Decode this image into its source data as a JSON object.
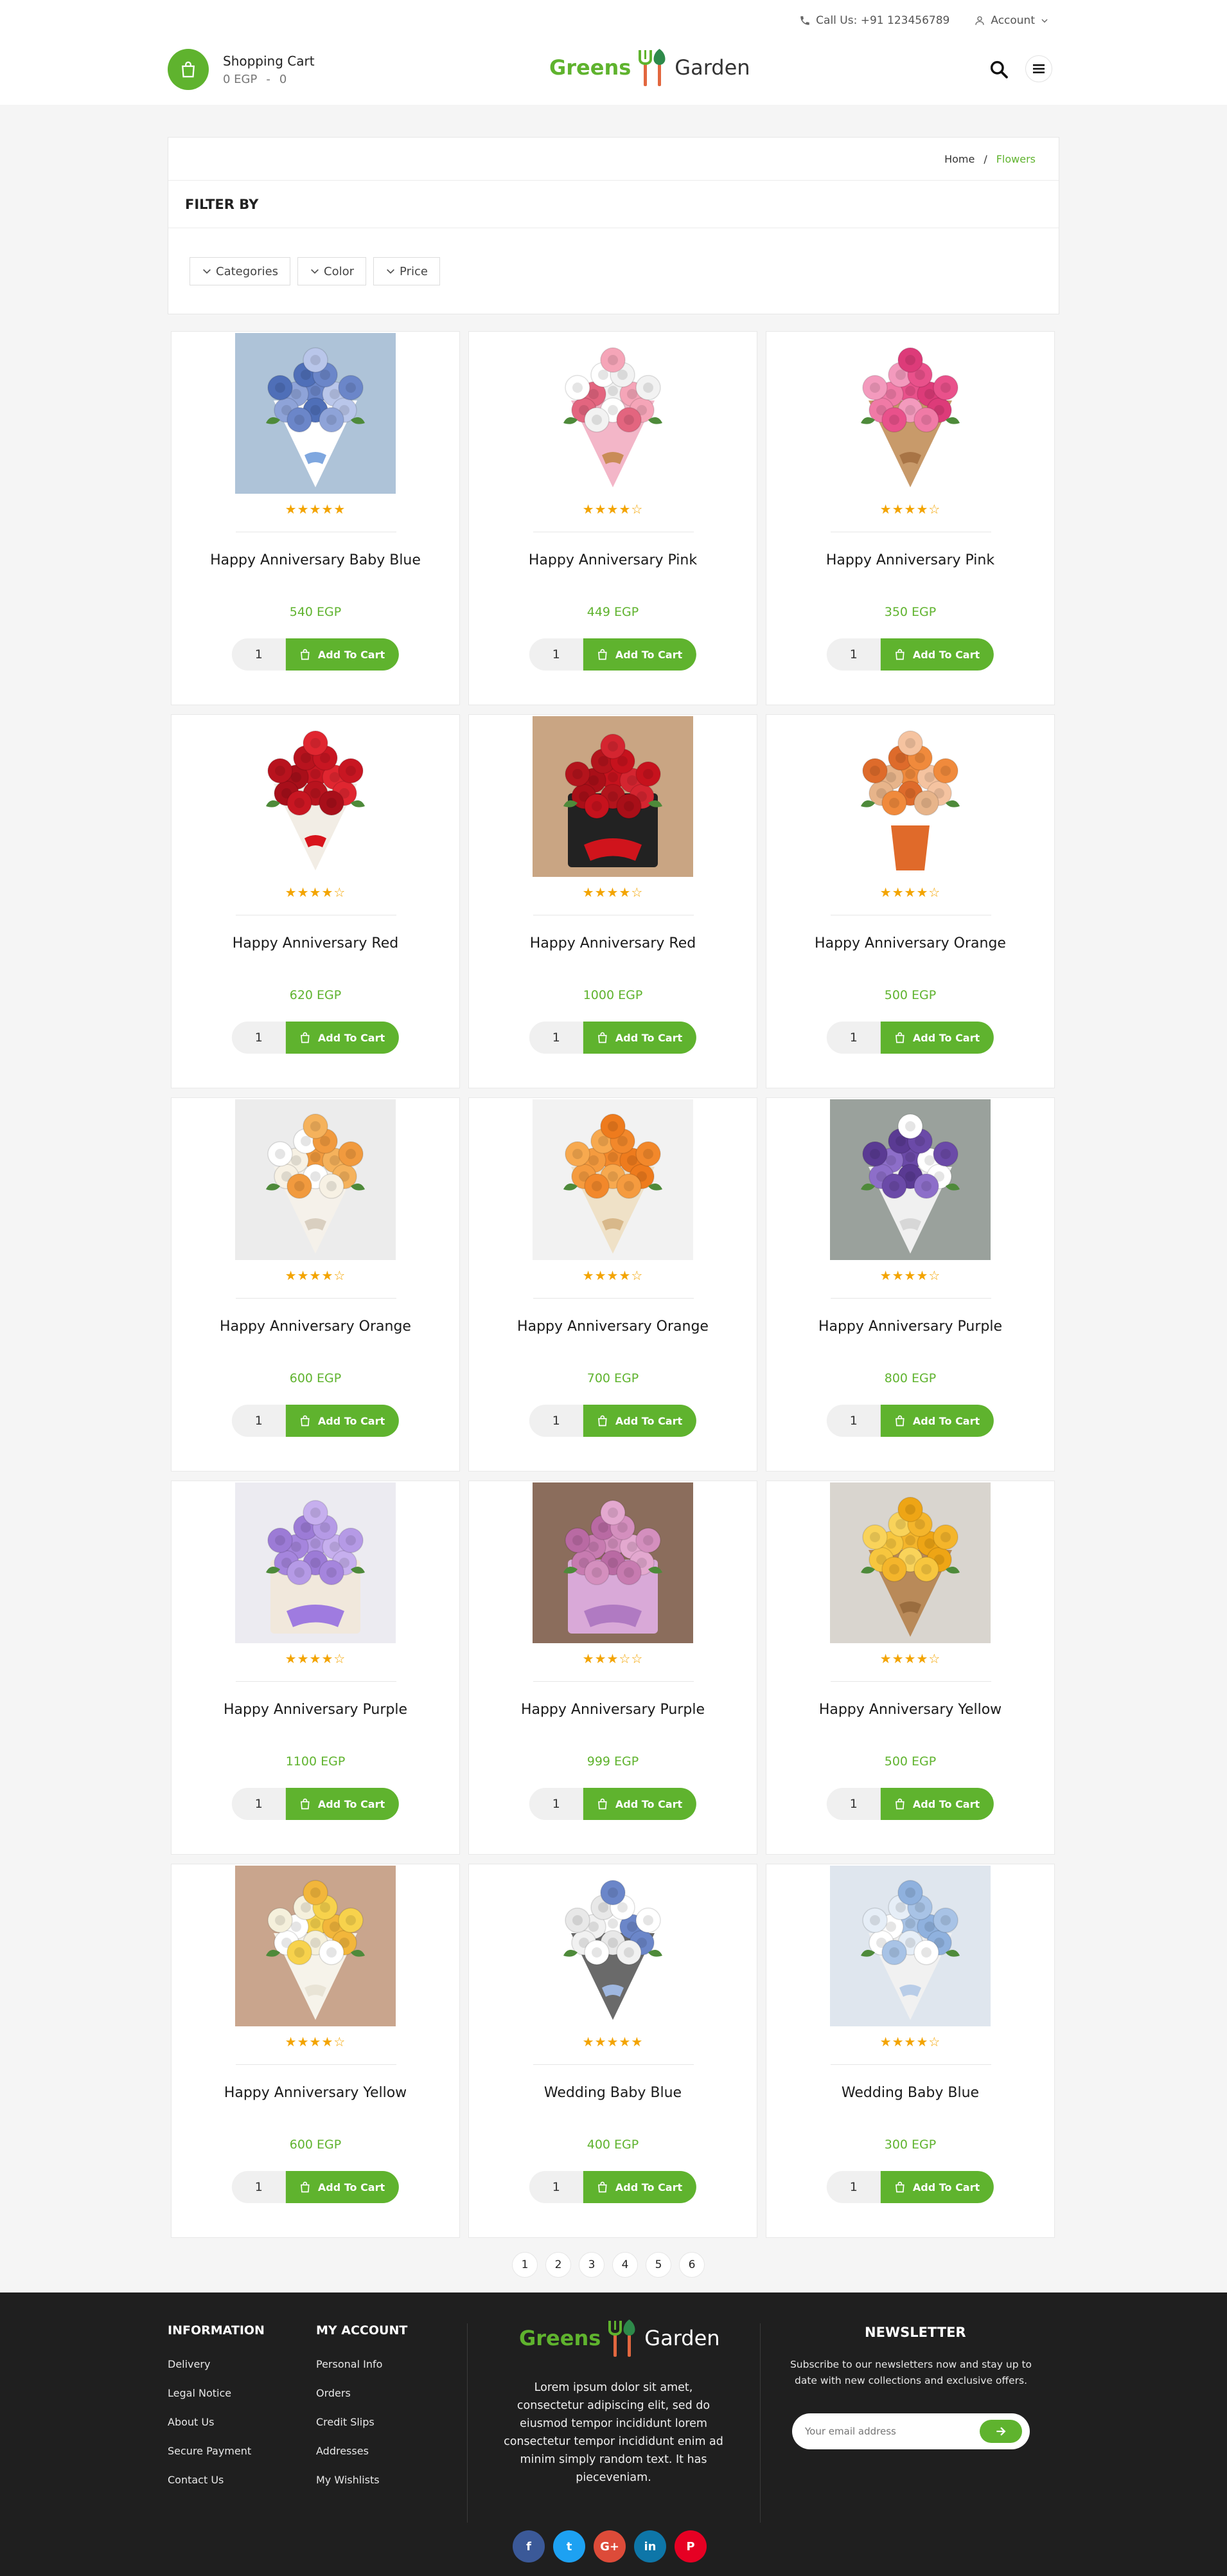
{
  "header": {
    "call_label": "Call Us: +91 123456789",
    "account_label": "Account",
    "cart_title": "Shopping Cart",
    "cart_total": "0 EGP",
    "cart_sep": "-",
    "cart_count": "0",
    "logo_left": "Greens",
    "logo_right": "Garden"
  },
  "breadcrumb": {
    "home": "Home",
    "sep": "/",
    "current": "Flowers"
  },
  "filter": {
    "title": "FILTER BY",
    "buttons": [
      "Categories",
      "Color",
      "Price"
    ]
  },
  "products": [
    {
      "name": "Happy Anniversary Baby Blue",
      "price": "540 EGP",
      "rating": 5,
      "qty": "1",
      "cta": "Add To Cart",
      "icon": "bouquet-baby-blue"
    },
    {
      "name": "Happy Anniversary Pink",
      "price": "449 EGP",
      "rating": 4,
      "qty": "1",
      "cta": "Add To Cart",
      "icon": "bouquet-pink-white"
    },
    {
      "name": "Happy Anniversary Pink",
      "price": "350 EGP",
      "rating": 4,
      "qty": "1",
      "cta": "Add To Cart",
      "icon": "bouquet-pink"
    },
    {
      "name": "Happy Anniversary Red",
      "price": "620 EGP",
      "rating": 4,
      "qty": "1",
      "cta": "Add To Cart",
      "icon": "bouquet-red"
    },
    {
      "name": "Happy Anniversary Red",
      "price": "1000 EGP",
      "rating": 4,
      "qty": "1",
      "cta": "Add To Cart",
      "icon": "box-red-roses"
    },
    {
      "name": "Happy Anniversary Orange",
      "price": "500 EGP",
      "rating": 4,
      "qty": "1",
      "cta": "Add To Cart",
      "icon": "vase-orange"
    },
    {
      "name": "Happy Anniversary Orange",
      "price": "600 EGP",
      "rating": 4,
      "qty": "1",
      "cta": "Add To Cart",
      "icon": "bouquet-orange-white"
    },
    {
      "name": "Happy Anniversary Orange",
      "price": "700 EGP",
      "rating": 4,
      "qty": "1",
      "cta": "Add To Cart",
      "icon": "bouquet-orange-cone"
    },
    {
      "name": "Happy Anniversary Purple",
      "price": "800 EGP",
      "rating": 4,
      "qty": "1",
      "cta": "Add To Cart",
      "icon": "bouquet-purple"
    },
    {
      "name": "Happy Anniversary Purple",
      "price": "1100 EGP",
      "rating": 4,
      "qty": "1",
      "cta": "Add To Cart",
      "icon": "box-purple-roses"
    },
    {
      "name": "Happy Anniversary Purple",
      "price": "999 EGP",
      "rating": 3,
      "qty": "1",
      "cta": "Add To Cart",
      "icon": "box-purple-tulips"
    },
    {
      "name": "Happy Anniversary Yellow",
      "price": "500 EGP",
      "rating": 4,
      "qty": "1",
      "cta": "Add To Cart",
      "icon": "bouquet-yellow"
    },
    {
      "name": "Happy Anniversary Yellow",
      "price": "600 EGP",
      "rating": 4,
      "qty": "1",
      "cta": "Add To Cart",
      "icon": "bouquet-yellow-white"
    },
    {
      "name": "Wedding Baby Blue",
      "price": "400 EGP",
      "rating": 5,
      "qty": "1",
      "cta": "Add To Cart",
      "icon": "bouquet-white-blue"
    },
    {
      "name": "Wedding Baby Blue",
      "price": "300 EGP",
      "rating": 4,
      "qty": "1",
      "cta": "Add To Cart",
      "icon": "bouquet-blue-white"
    }
  ],
  "pagination": [
    "1",
    "2",
    "3",
    "4",
    "5",
    "6"
  ],
  "footer": {
    "info_title": "INFORMATION",
    "info_links": [
      "Delivery",
      "Legal Notice",
      "About Us",
      "Secure Payment",
      "Contact Us"
    ],
    "account_title": "MY ACCOUNT",
    "account_links": [
      "Personal Info",
      "Orders",
      "Credit Slips",
      "Addresses",
      "My Wishlists"
    ],
    "logo_left": "Greens",
    "logo_right": "Garden",
    "description": "Lorem ipsum dolor sit amet, consectetur adipiscing elit, sed do eiusmod tempor incididunt lorem consectetur tempor incididunt enim ad minim simply random text. It has pieceveniam.",
    "socials": [
      {
        "name": "facebook",
        "glyph": "f",
        "color": "#3b5998"
      },
      {
        "name": "twitter",
        "glyph": "t",
        "color": "#1da1f2"
      },
      {
        "name": "google-plus",
        "glyph": "G+",
        "color": "#dd4b39"
      },
      {
        "name": "linkedin",
        "glyph": "in",
        "color": "#0e76a8"
      },
      {
        "name": "pinterest",
        "glyph": "P",
        "color": "#e60023"
      }
    ],
    "newsletter_title": "NEWSLETTER",
    "newsletter_text": "Subscribe to our newsletters now and stay up to date with new collections and exclusive offers.",
    "newsletter_placeholder": "Your email address"
  },
  "colors": {
    "accent": "#5fb32e",
    "star": "#f3a400",
    "footer_bg": "#1f1f1f"
  }
}
